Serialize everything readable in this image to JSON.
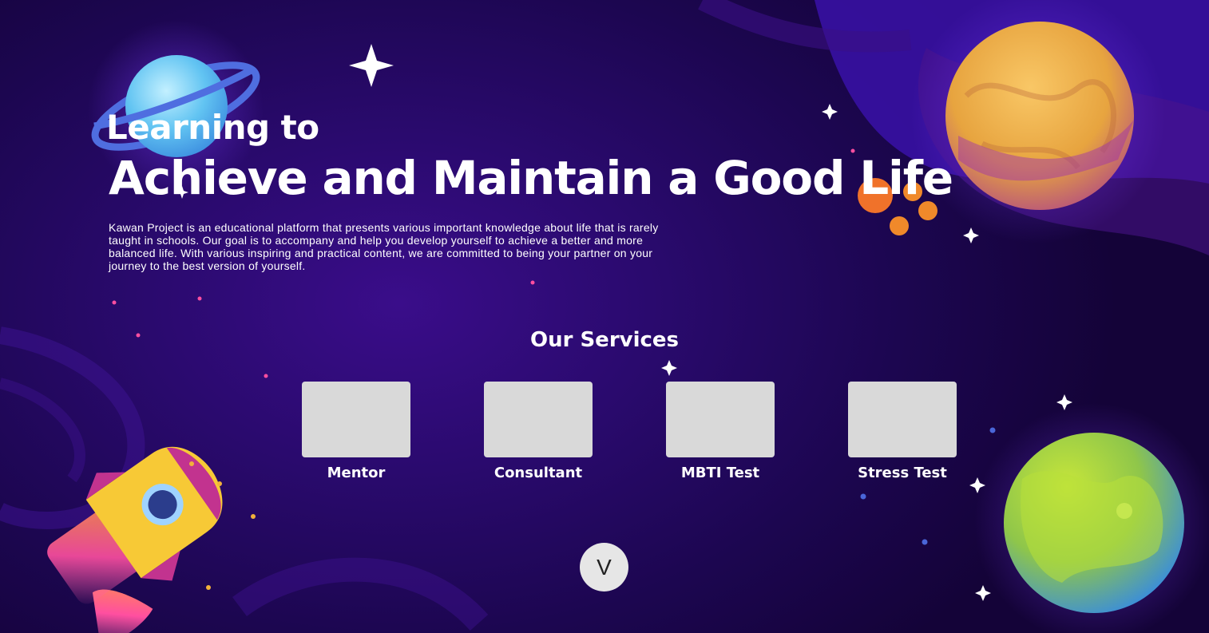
{
  "hero": {
    "subtitle": "Learning to",
    "title": "Achieve and Maintain a Good Life",
    "description": "Kawan Project is an educational platform that presents various important knowledge about life that is rarely taught in schools. Our goal is to accompany and help you develop yourself to achieve a better and more balanced life. With various inspiring and practical content, we are committed to being your partner on your journey to the best version of yourself."
  },
  "services": {
    "title": "Our Services",
    "items": [
      {
        "label": "Mentor"
      },
      {
        "label": "Consultant"
      },
      {
        "label": "MBTI Test"
      },
      {
        "label": "Stress Test"
      }
    ]
  },
  "scroll_button": {
    "label": "V"
  },
  "icons": [
    "blue-ringed-planet-icon",
    "orange-planet-icon",
    "green-planet-icon",
    "rocket-icon",
    "sparkle-star-icon"
  ],
  "colors": {
    "background": "#1c0650",
    "accent_purple": "#3a0d8a",
    "card_placeholder": "#d9d9d9",
    "text": "#ffffff"
  }
}
